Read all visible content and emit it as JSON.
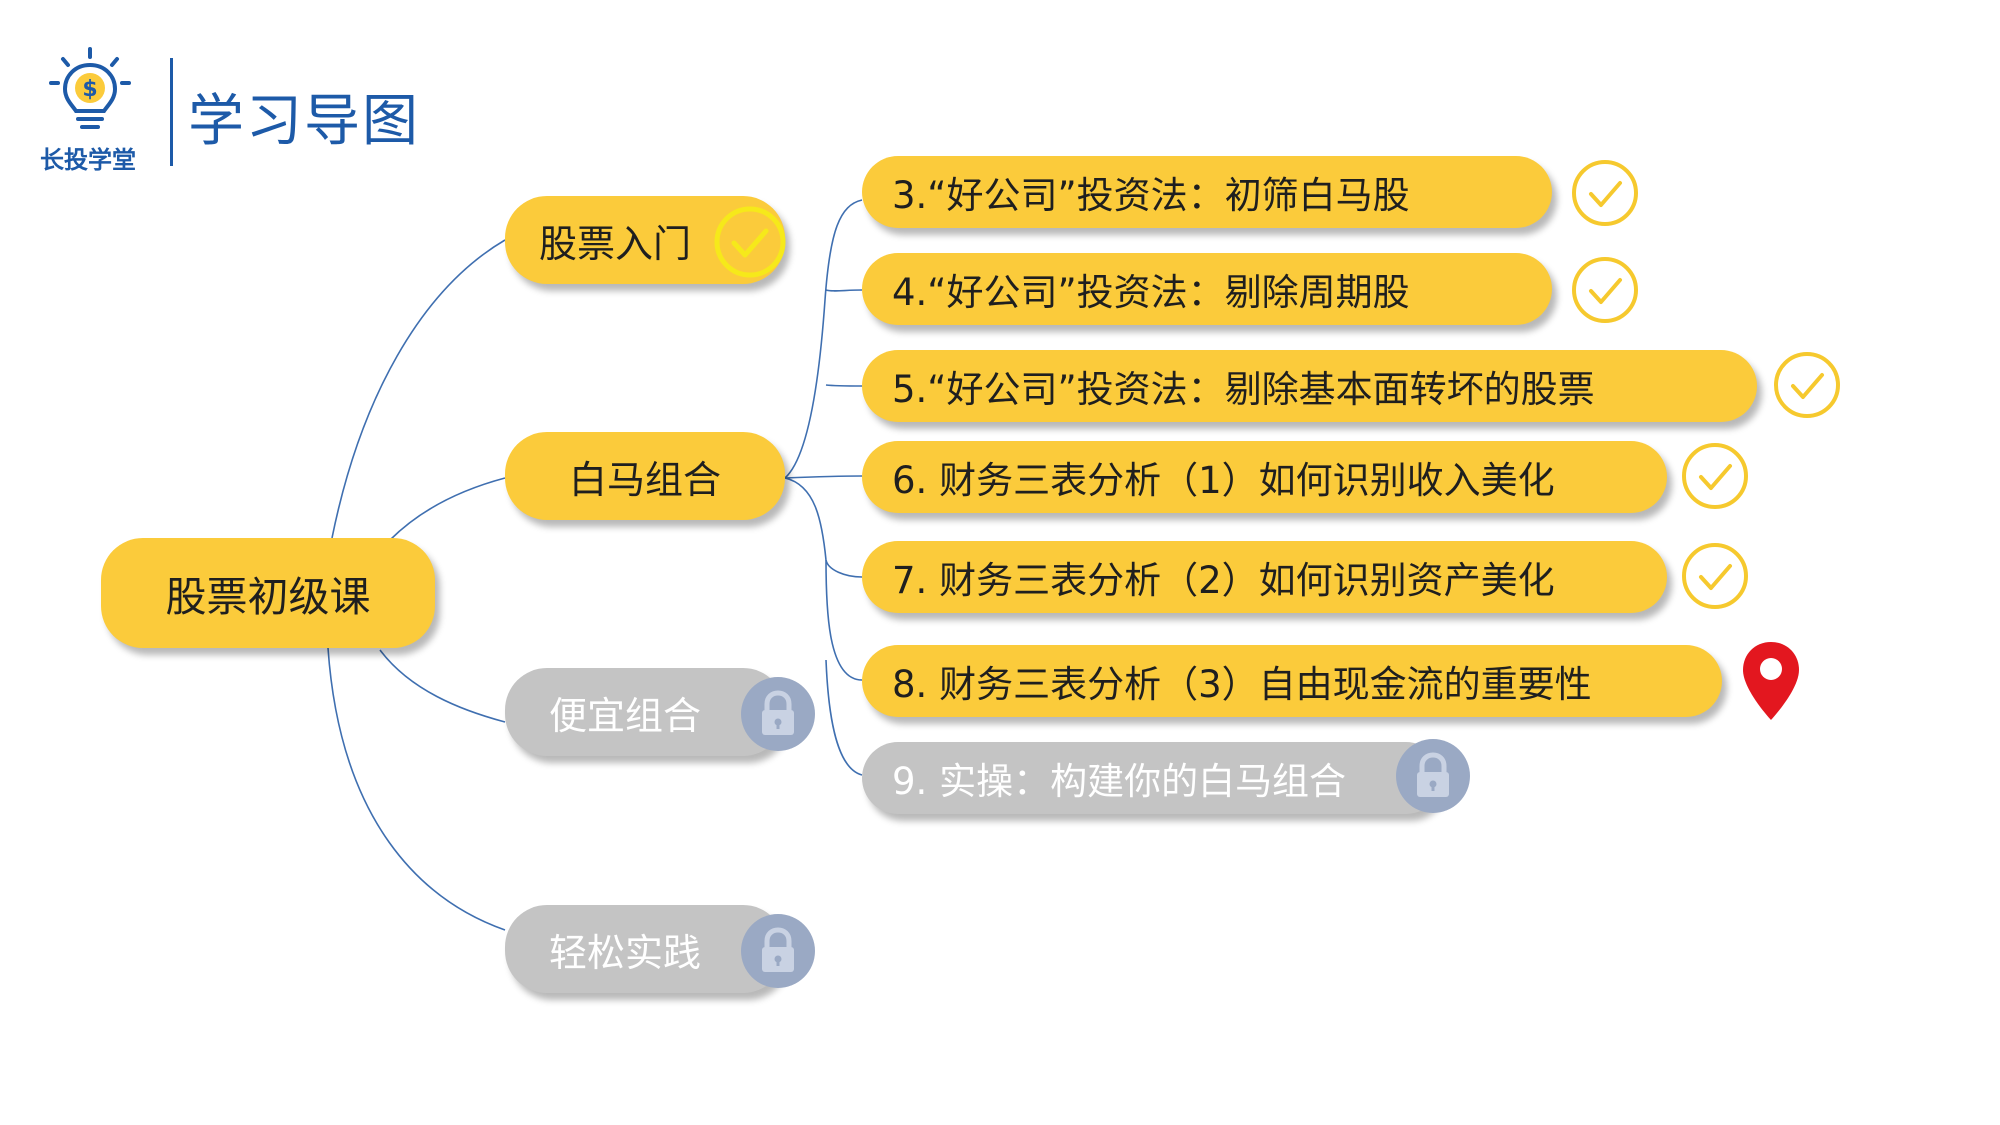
{
  "header": {
    "logo_text": "长投学堂",
    "title": "学习导图"
  },
  "colors": {
    "accent_yellow": "#fbcb3b",
    "locked_gray": "#c4c4c4",
    "brand_blue": "#1d5aa8",
    "check_yellow": "#f6c92e",
    "marker_red": "#e3171f",
    "lock_blue": "#9aa9c4"
  },
  "mindmap": {
    "root": "股票初级课",
    "branches": [
      {
        "label": "股票入门",
        "status": "completed",
        "icon": "check-icon"
      },
      {
        "label": "白马组合",
        "status": "in-progress",
        "icon": ""
      },
      {
        "label": "便宜组合",
        "status": "locked",
        "icon": "lock-icon"
      },
      {
        "label": "轻松实践",
        "status": "locked",
        "icon": "lock-icon"
      }
    ],
    "lessons": [
      {
        "label": "3.“好公司”投资法：初筛白马股",
        "status": "completed",
        "icon": "check-icon"
      },
      {
        "label": "4.“好公司”投资法：剔除周期股",
        "status": "completed",
        "icon": "check-icon"
      },
      {
        "label": "5.“好公司”投资法：剔除基本面转坏的股票",
        "status": "completed",
        "icon": "check-icon"
      },
      {
        "label": "6. 财务三表分析（1）如何识别收入美化",
        "status": "completed",
        "icon": "check-icon"
      },
      {
        "label": "7. 财务三表分析（2）如何识别资产美化",
        "status": "completed",
        "icon": "check-icon"
      },
      {
        "label": "8. 财务三表分析（3）自由现金流的重要性",
        "status": "current",
        "icon": "location-pin-icon"
      },
      {
        "label": "9. 实操：构建你的白马组合",
        "status": "locked",
        "icon": "lock-icon"
      }
    ]
  }
}
